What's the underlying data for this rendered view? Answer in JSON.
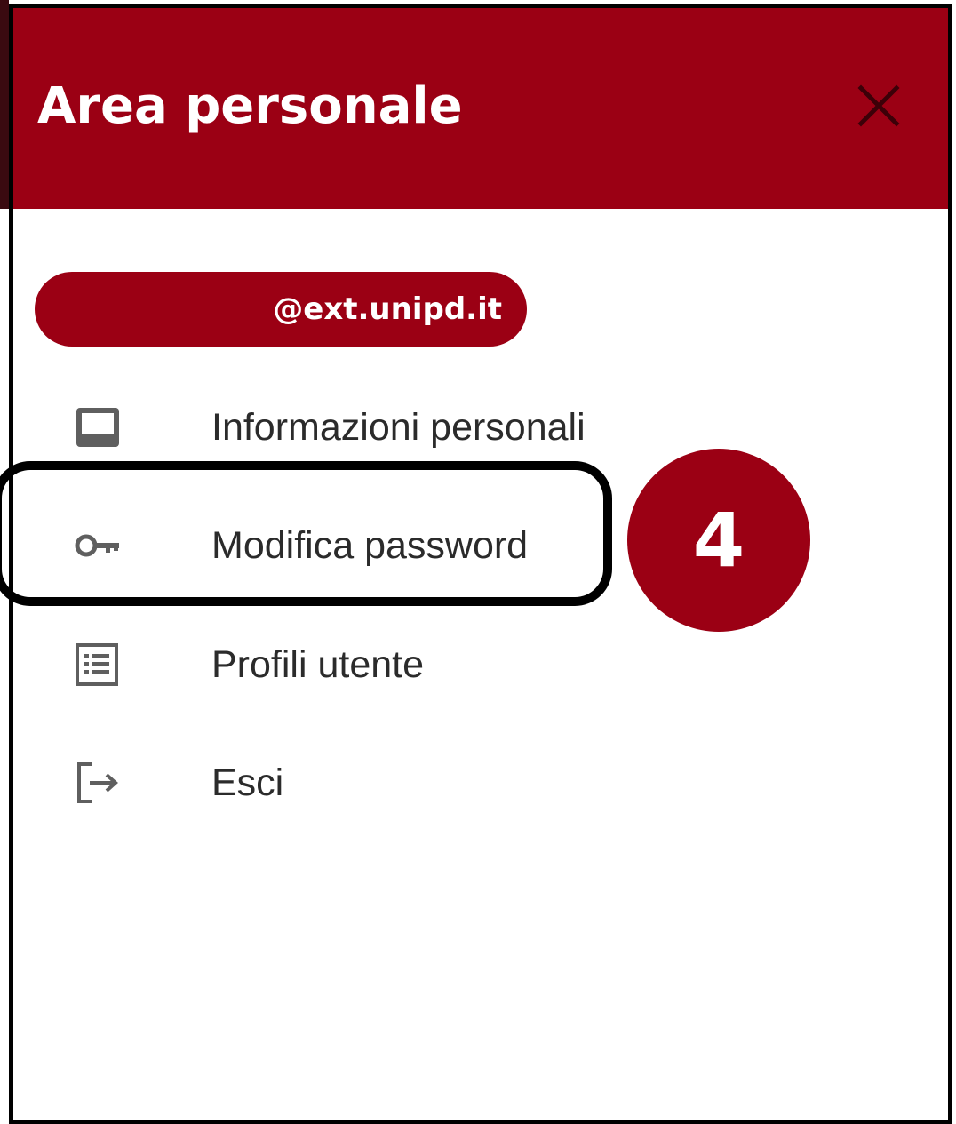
{
  "header": {
    "title": "Area personale",
    "close_icon": "close-icon"
  },
  "user": {
    "email": "@ext.unipd.it"
  },
  "menu": {
    "items": [
      {
        "label": "Informazioni personali",
        "icon": "inbox-icon"
      },
      {
        "label": "Modifica password",
        "icon": "key-icon"
      },
      {
        "label": "Profili utente",
        "icon": "list-icon"
      },
      {
        "label": "Esci",
        "icon": "logout-icon"
      }
    ]
  },
  "annotation": {
    "step_number": "4"
  },
  "colors": {
    "brand": "#9b0014",
    "header_text": "#ffffff",
    "menu_text": "#2b2b2b",
    "icon": "#5f5f5f",
    "annotation_border": "#000000"
  }
}
